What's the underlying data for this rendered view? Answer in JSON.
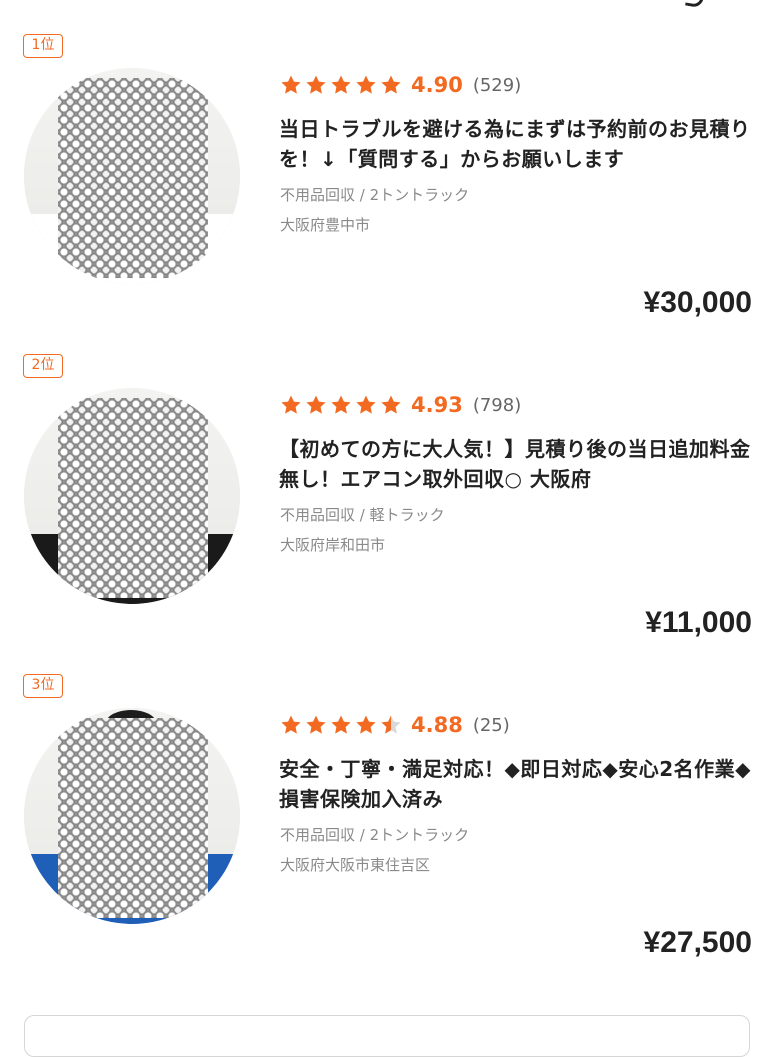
{
  "colors": {
    "accent": "#f26a22",
    "star_empty": "#d9d9d9",
    "muted_text": "#8a8a8a"
  },
  "pros": [
    {
      "rank_label": "1位",
      "rating": 4.9,
      "rating_text": "4.90",
      "review_count": "(529)",
      "stars": [
        1,
        1,
        1,
        1,
        1
      ],
      "title": "当日トラブルを避ける為にまずは予約前のお見積りを！↓「質問する」からお願いします",
      "category": "不用品回収 / 2トントラック",
      "location": "大阪府豊中市",
      "price": "¥30,000",
      "shirt_color": "#ffffff"
    },
    {
      "rank_label": "2位",
      "rating": 4.93,
      "rating_text": "4.93",
      "review_count": "(798)",
      "stars": [
        1,
        1,
        1,
        1,
        1
      ],
      "title": "【初めての方に大人気！】見積り後の当日追加料金無し！エアコン取外回収○ 大阪府",
      "category": "不用品回収 / 軽トラック",
      "location": "大阪府岸和田市",
      "price": "¥11,000",
      "shirt_color": "#1a1a1a"
    },
    {
      "rank_label": "3位",
      "rating": 4.88,
      "rating_text": "4.88",
      "review_count": "(25)",
      "stars": [
        1,
        1,
        1,
        1,
        0.5
      ],
      "title": "安全・丁寧・満足対応！◆即日対応◆安心2名作業◆損害保険加入済み",
      "category": "不用品回収 / 2トントラック",
      "location": "大阪府大阪市東住吉区",
      "price": "¥27,500",
      "shirt_color": "#1f5fb8"
    }
  ]
}
